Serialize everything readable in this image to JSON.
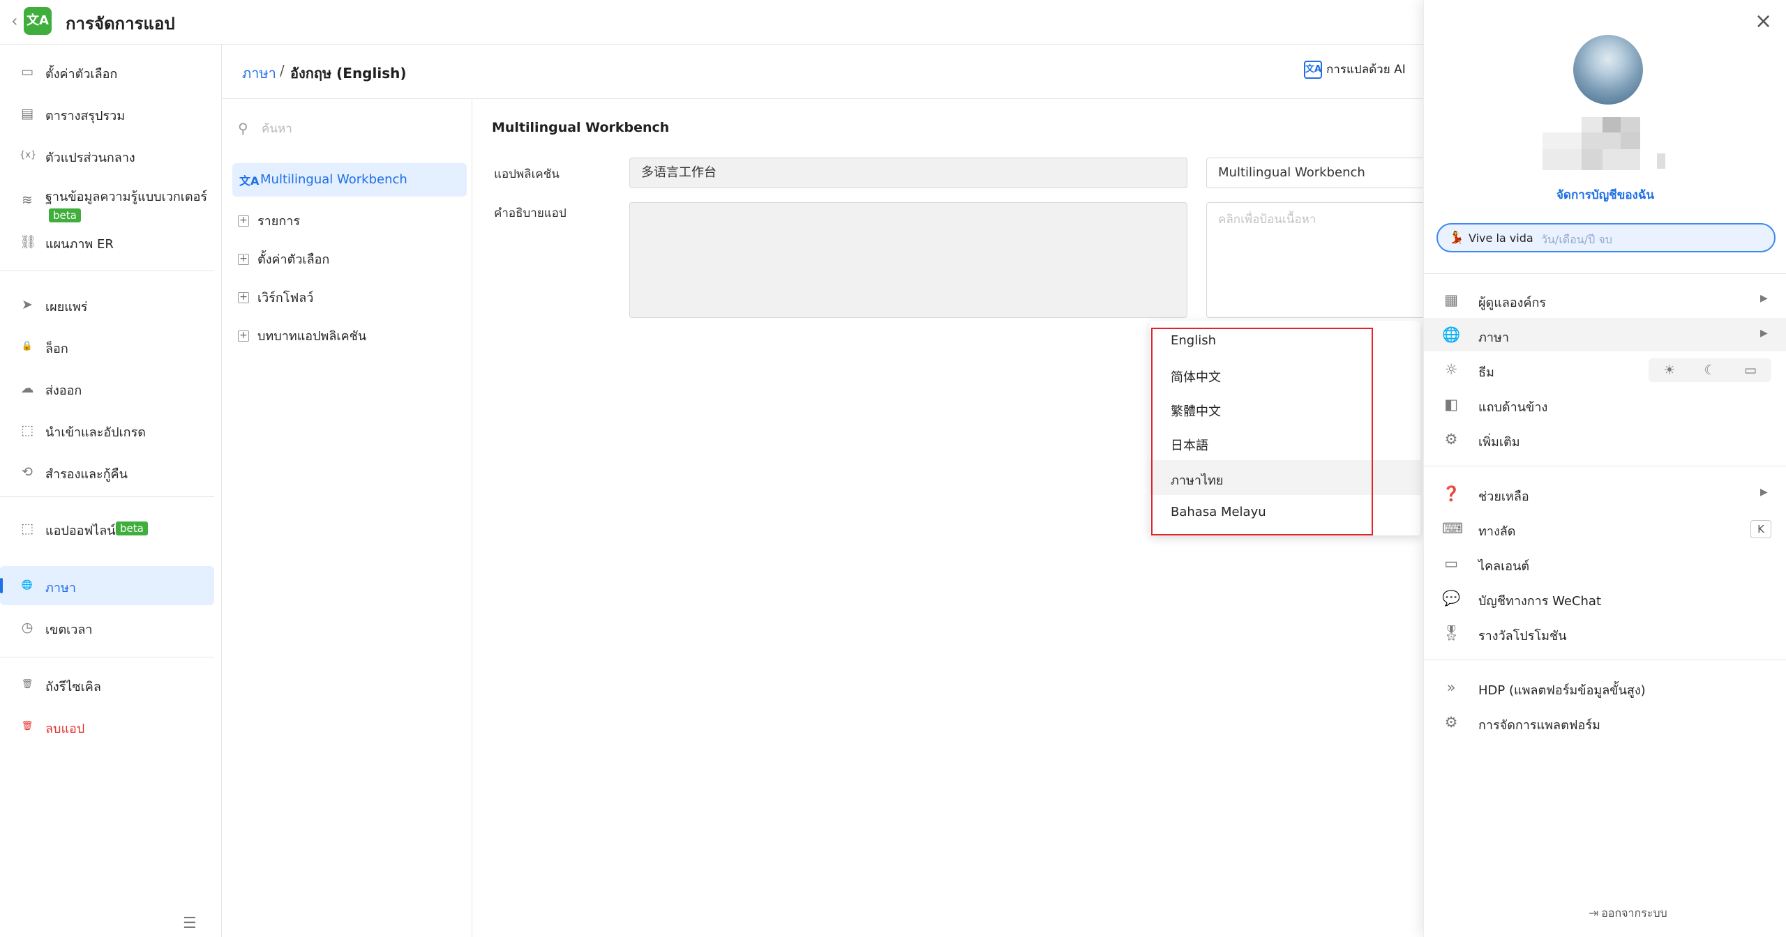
{
  "app": {
    "title": "การจัดการแอป",
    "logo_glyph": "文A"
  },
  "sidebar": {
    "items": [
      {
        "label": "ตั้งค่าตัวเลือก",
        "icon": "settings-card-icon"
      },
      {
        "label": "ตารางสรุปรวม",
        "icon": "table-stack-icon"
      },
      {
        "label": "ตัวแปรส่วนกลาง",
        "icon": "variable-braces-icon"
      },
      {
        "label": "ฐานข้อมูลความรู้แบบเวกเตอร์",
        "badge": "beta",
        "icon": "database-icon"
      },
      {
        "label": "แผนภาพ ER",
        "icon": "er-diagram-icon"
      },
      {
        "label": "เผยแพร่",
        "icon": "send-icon"
      },
      {
        "label": "ล็อก",
        "icon": "lock-icon"
      },
      {
        "label": "ส่งออก",
        "icon": "cloud-upload-icon"
      },
      {
        "label": "นำเข้าและอัปเกรด",
        "icon": "import-box-icon"
      },
      {
        "label": "สำรองและกู้คืน",
        "icon": "backup-restore-icon"
      },
      {
        "label": "แอปออฟไลน์",
        "badge": "beta",
        "icon": "offline-app-icon"
      },
      {
        "label": "ภาษา",
        "icon": "globe-icon",
        "active": true
      },
      {
        "label": "เขตเวลา",
        "icon": "clock-icon"
      },
      {
        "label": "ถังรีไซเคิล",
        "icon": "recycle-bin-icon"
      },
      {
        "label": "ลบแอป",
        "icon": "trash-icon",
        "danger": true
      }
    ]
  },
  "breadcrumb": {
    "link": "ภาษา",
    "separator": "/",
    "current": "อังกฤษ (English)"
  },
  "ai_translate": {
    "icon_glyph": "文A",
    "label": "การแปลด้วย AI"
  },
  "tree": {
    "search_placeholder": "ค้นหา",
    "selected": {
      "icon_glyph": "文A",
      "label": "Multilingual Workbench"
    },
    "nodes": [
      "รายการ",
      "ตั้งค่าตัวเลือก",
      "เวิร์กโฟลว์",
      "บทบาทแอปพลิเคชัน"
    ]
  },
  "form": {
    "section_title": "Multilingual Workbench",
    "app_label": "แอปพลิเคชัน",
    "app_source_value": "多语言工作台",
    "app_translation_value": "Multilingual Workbench",
    "desc_label": "คำอธิบายแอป",
    "desc_placeholder": "คลิกเพื่อป้อนเนื้อหา"
  },
  "language_dropdown": {
    "options": [
      "English",
      "简体中文",
      "繁體中文",
      "日本語",
      "ภาษาไทย",
      "Bahasa Melayu"
    ],
    "hovered": "ภาษาไทย"
  },
  "account_panel": {
    "manage_account": "จัดการบัญชีของฉัน",
    "status": {
      "icon": "dancer-emoji-icon",
      "name": "Vive la vida",
      "date_placeholder": "วัน/เดือน/ปี จบ"
    },
    "menu_group1": [
      {
        "label": "ผู้ดูแลองค์กร",
        "icon": "building-icon",
        "arrow": true
      },
      {
        "label": "ภาษา",
        "icon": "globe-icon",
        "arrow": true,
        "hover": true
      },
      {
        "label": "ธีม",
        "icon": "theme-sun-icon"
      },
      {
        "label": "แถบด้านข้าง",
        "icon": "sidebar-icon"
      },
      {
        "label": "เพิ่มเติม",
        "icon": "gear-icon"
      }
    ],
    "theme_options": [
      "light-sun-icon",
      "dark-moon-icon",
      "system-laptop-icon"
    ],
    "menu_group2": [
      {
        "label": "ช่วยเหลือ",
        "icon": "help-circle-icon",
        "arrow": true
      },
      {
        "label": "ทางลัด",
        "icon": "keyboard-icon",
        "shortcut": "K"
      },
      {
        "label": "ไคลเอนต์",
        "icon": "client-devices-icon"
      },
      {
        "label": "บัญชีทางการ WeChat",
        "icon": "wechat-icon"
      },
      {
        "label": "รางวัลโปรโมชัน",
        "icon": "award-icon"
      }
    ],
    "menu_group3": [
      {
        "label": "HDP (แพลตฟอร์มข้อมูลขั้นสูง)",
        "icon": "hdp-chevrons-icon"
      },
      {
        "label": "การจัดการแพลตฟอร์ม",
        "icon": "platform-gear-icon"
      }
    ],
    "logout": "ออกจากระบบ"
  }
}
